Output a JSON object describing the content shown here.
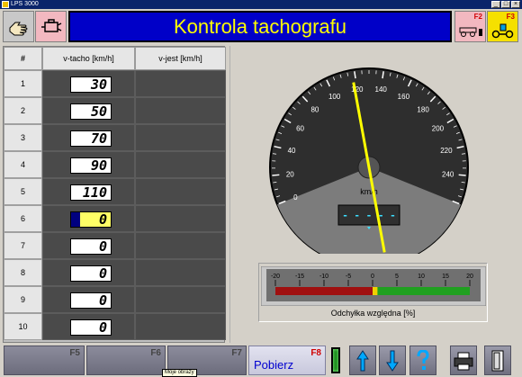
{
  "window": {
    "title": "LPS 3000",
    "min": "_",
    "max": "□",
    "close": "×"
  },
  "header": {
    "title": "Kontrola tachografu",
    "f2_key": "F2",
    "f3_key": "F3"
  },
  "table": {
    "headers": {
      "num": "#",
      "v_tacho": "v-tacho [km/h]",
      "v_jest": "v-jest [km/h]"
    },
    "rows": [
      {
        "n": "1",
        "v_tacho": "30",
        "v_jest": ""
      },
      {
        "n": "2",
        "v_tacho": "50",
        "v_jest": ""
      },
      {
        "n": "3",
        "v_tacho": "70",
        "v_jest": ""
      },
      {
        "n": "4",
        "v_tacho": "90",
        "v_jest": ""
      },
      {
        "n": "5",
        "v_tacho": "110",
        "v_jest": ""
      },
      {
        "n": "6",
        "v_tacho": "0",
        "v_jest": ""
      },
      {
        "n": "7",
        "v_tacho": "0",
        "v_jest": ""
      },
      {
        "n": "8",
        "v_tacho": "0",
        "v_jest": ""
      },
      {
        "n": "9",
        "v_tacho": "0",
        "v_jest": ""
      },
      {
        "n": "10",
        "v_tacho": "0",
        "v_jest": ""
      }
    ],
    "active_row": 6
  },
  "speedometer": {
    "unit": "km/h",
    "ticks": [
      "0",
      "20",
      "40",
      "60",
      "80",
      "100",
      "120",
      "140",
      "160",
      "180",
      "200",
      "220",
      "240"
    ],
    "max": 260,
    "needle_value": 118,
    "display": "- - - - -",
    "needle_color": "#ffff00"
  },
  "deviation": {
    "label": "Odchyłka względna [%]",
    "ticks": [
      "-20",
      "-15",
      "-10",
      "-5",
      "0",
      "5",
      "10",
      "15",
      "20"
    ],
    "range": [
      -20,
      20
    ],
    "value": 1
  },
  "bottom": {
    "f5": "F5",
    "f6": "F6",
    "f7": "F7",
    "f8": "F8",
    "pobierz": "Pobierz",
    "tooltip": "Moje obrazy"
  },
  "colors": {
    "title_bg": "#0000c8",
    "title_fg": "#ffff00",
    "cell_bg": "#4a4a4a"
  }
}
